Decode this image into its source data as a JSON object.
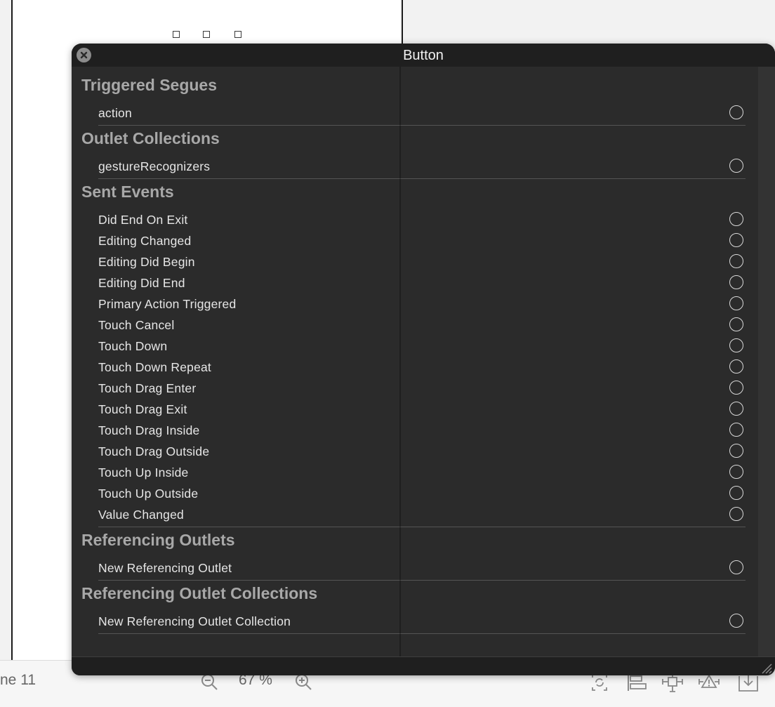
{
  "bottom_bar": {
    "device_label": "ne 11",
    "zoom_level": "67 %"
  },
  "panel": {
    "title": "Button",
    "sections": [
      {
        "header": "Triggered Segues",
        "items": [
          "action"
        ]
      },
      {
        "header": "Outlet Collections",
        "items": [
          "gestureRecognizers"
        ]
      },
      {
        "header": "Sent Events",
        "items": [
          "Did End On Exit",
          "Editing Changed",
          "Editing Did Begin",
          "Editing Did End",
          "Primary Action Triggered",
          "Touch Cancel",
          "Touch Down",
          "Touch Down Repeat",
          "Touch Drag Enter",
          "Touch Drag Exit",
          "Touch Drag Inside",
          "Touch Drag Outside",
          "Touch Up Inside",
          "Touch Up Outside",
          "Value Changed"
        ]
      },
      {
        "header": "Referencing Outlets",
        "items": [
          "New Referencing Outlet"
        ]
      },
      {
        "header": "Referencing Outlet Collections",
        "items": [
          "New Referencing Outlet Collection"
        ]
      }
    ]
  },
  "icons": {
    "close": "close-icon",
    "connector": "connection-circle-icon",
    "zoom_out": "zoom-out-icon",
    "zoom_in": "zoom-in-icon",
    "update_frames": "update-frames-icon",
    "align": "align-icon",
    "add_constraints": "add-constraints-icon",
    "resolve_issues": "resolve-autolayout-issues-icon",
    "embed_in": "embed-in-icon",
    "resize": "resize-grip-icon"
  },
  "colors": {
    "panel_bg": "#2b2b2b",
    "titlebar_bg": "#1f1f1f",
    "section_header": "#a8a8a8",
    "row_text": "#e6e6e6",
    "canvas_bg": "#f2f2f2"
  }
}
